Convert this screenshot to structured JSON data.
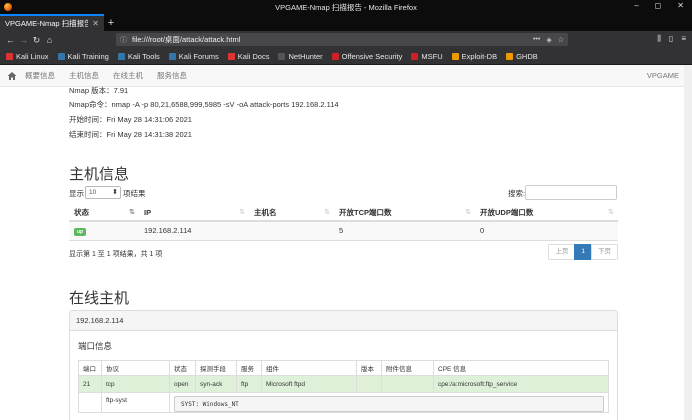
{
  "window": {
    "title": "VPGAME-Nmap 扫描报告 - Mozilla Firefox"
  },
  "tab": {
    "title": "VPGAME-Nmap 扫描报告"
  },
  "url": "file:///root/桌面/attack/attack.html",
  "bookmarks": [
    "Kali Linux",
    "Kali Training",
    "Kali Tools",
    "Kali Forums",
    "Kali Docs",
    "NetHunter",
    "Offensive Security",
    "MSFU",
    "Exploit-DB",
    "GHDB"
  ],
  "page_nav": {
    "links": [
      "概要信息",
      "主机信息",
      "在线主机",
      "服务信息"
    ],
    "brand": "VPGAME"
  },
  "meta": {
    "version": "Nmap 版本：7.91",
    "command": "Nmap命令：nmap -A -p 80,21,6588,999,5985 -sV -oA attack-ports 192.168.2.114",
    "start": "开始时间：Fri May 28 14:31:06 2021",
    "end": "结束时间：Fri May 28 14:31:38 2021"
  },
  "hosts": {
    "title": "主机信息",
    "show_label": "显示",
    "page_size": "10",
    "entries_label": "项结果",
    "search_label": "搜索:",
    "columns": [
      "状态",
      "IP",
      "主机名",
      "开放TCP端口数",
      "开放UDP端口数"
    ],
    "rows": [
      {
        "status": "up",
        "ip": "192.168.2.114",
        "hostname": "",
        "tcp": "5",
        "udp": "0"
      }
    ],
    "info": "显示第 1 至 1 项结果，共 1 项",
    "pager": {
      "prev": "上页",
      "current": "1",
      "next": "下页"
    }
  },
  "online": {
    "title": "在线主机",
    "host_ip": "192.168.2.114",
    "port_info_title": "端口信息",
    "columns": [
      "端口",
      "协议",
      "状态",
      "探测手段",
      "服务",
      "组件",
      "版本",
      "附件信息",
      "CPE 信息"
    ],
    "rows": [
      {
        "port": "21",
        "protocol": "tcp",
        "state": "open",
        "reason": "syn-ack",
        "service": "ftp",
        "product": "Microsoft ftpd",
        "version": "",
        "extra": "",
        "cpe": "cpe:/a:microsoft:ftp_service"
      }
    ],
    "script": {
      "name": "ftp-syst",
      "output": "SYST: Windows_NT"
    }
  }
}
